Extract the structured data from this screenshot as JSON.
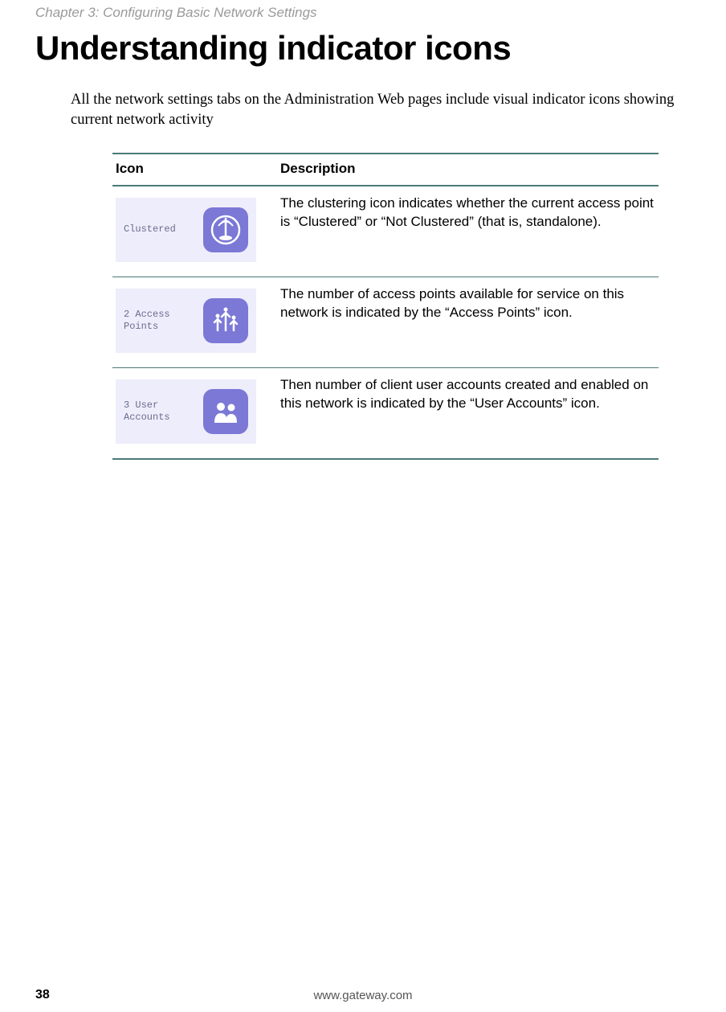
{
  "header": {
    "running_head": "Chapter 3: Configuring Basic Network Settings"
  },
  "title": "Understanding indicator icons",
  "intro": "All the network settings tabs on the Administration Web pages include visual indicator icons showing current network activity",
  "table": {
    "head": {
      "icon": "Icon",
      "desc": "Description"
    },
    "rows": [
      {
        "icon_label": "Clustered",
        "icon_name": "clustered-icon",
        "desc": "The clustering icon indicates whether the current access point is “Clustered” or “Not Clustered” (that is, standalone)."
      },
      {
        "icon_label": "2 Access Points",
        "icon_name": "access-points-icon",
        "desc": "The number of access points available for service on this network is indicated by the “Access Points” icon."
      },
      {
        "icon_label": "3 User Accounts",
        "icon_name": "user-accounts-icon",
        "desc": "Then number of client user accounts created and enabled on this network is indicated by the “User Accounts” icon."
      }
    ]
  },
  "footer": {
    "page_number": "38",
    "url": "www.gateway.com"
  }
}
